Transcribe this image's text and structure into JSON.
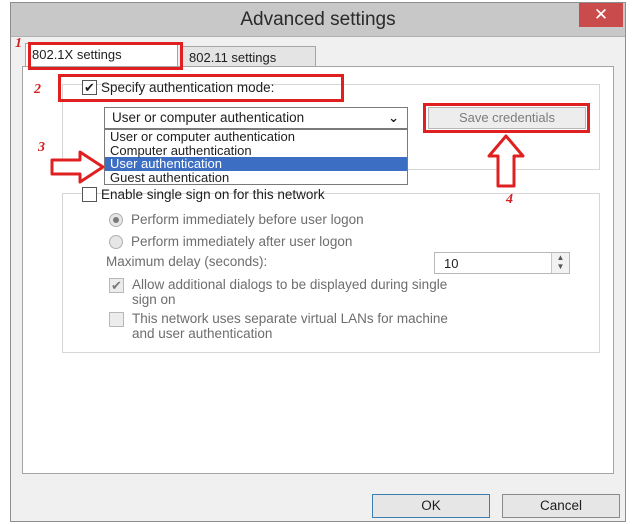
{
  "window": {
    "title": "Advanced settings",
    "close_glyph": "✕"
  },
  "tabs": [
    {
      "label": "802.1X settings",
      "active": true
    },
    {
      "label": "802.11 settings",
      "active": false
    }
  ],
  "auth_mode": {
    "checkbox_label": "Specify authentication mode:",
    "checked": true,
    "selected_value": "User or computer authentication",
    "options": [
      "User or computer authentication",
      "Computer authentication",
      "User authentication",
      "Guest authentication"
    ],
    "highlighted_option": "User authentication",
    "save_credentials_label": "Save credentials"
  },
  "sso": {
    "checkbox_label": "Enable single sign on for this network",
    "checked": false,
    "radio_before": "Perform immediately before user logon",
    "radio_after": "Perform immediately after user logon",
    "max_delay_label": "Maximum delay (seconds):",
    "max_delay_value": "10",
    "allow_dialogs_label_line1": "Allow additional dialogs to be displayed during single",
    "allow_dialogs_label_line2": "sign on",
    "allow_dialogs_checked": true,
    "vlan_label_line1": "This network uses separate virtual LANs for machine",
    "vlan_label_line2": "and user authentication",
    "vlan_checked": false
  },
  "buttons": {
    "ok": "OK",
    "cancel": "Cancel"
  },
  "annotations": {
    "step1": "1",
    "step2": "2",
    "step3": "3",
    "step4": "4",
    "color": "#e02020"
  },
  "icons": {
    "check": "check-icon",
    "dropdown": "chevron-down-icon",
    "spin": "spin-arrows-icon",
    "close": "close-icon",
    "arrow_right": "arrow-right-annotation",
    "arrow_up": "arrow-up-annotation"
  }
}
